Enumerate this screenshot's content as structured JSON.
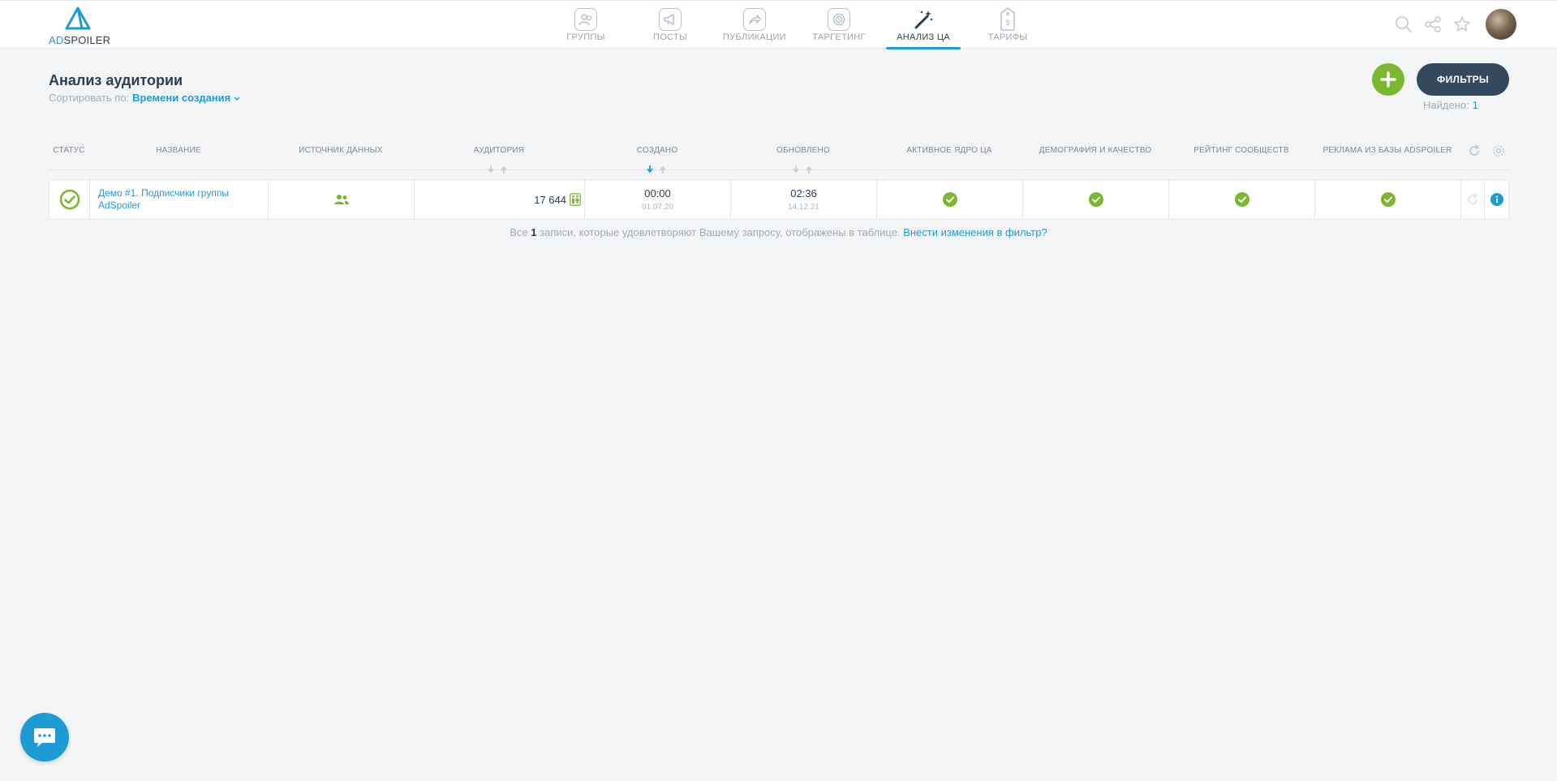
{
  "brand": {
    "logo_ad": "AD",
    "logo_rest": "SPOILER",
    "accent": "#1e9bd7",
    "green": "#7cb82f",
    "dark": "#34495e"
  },
  "nav": [
    {
      "label": "ГРУППЫ",
      "icon": "groups-icon"
    },
    {
      "label": "ПОСТЫ",
      "icon": "megaphone-icon"
    },
    {
      "label": "ПУБЛИКАЦИИ",
      "icon": "share-arrow-icon"
    },
    {
      "label": "ТАРГЕТИНГ",
      "icon": "target-icon"
    },
    {
      "label": "АНАЛИЗ ЦА",
      "icon": "magic-wand-icon",
      "active": true
    },
    {
      "label": "ТАРИФЫ",
      "icon": "price-tag-icon"
    }
  ],
  "page": {
    "title": "Анализ аудитории",
    "sort_label": "Сортировать по:",
    "sort_value": "Времени создания",
    "filters_button": "ФИЛЬТРЫ",
    "found_label": "Найдено:",
    "found_count": "1"
  },
  "table": {
    "headers": {
      "status": "СТАТУС",
      "name": "НАЗВАНИЕ",
      "source": "ИСТОЧНИК ДАННЫХ",
      "audience": "АУДИТОРИЯ",
      "created": "СОЗДАНО",
      "updated": "ОБНОВЛЕНО",
      "core": "АКТИВНОЕ ЯДРО ЦА",
      "demo": "ДЕМОГРАФИЯ И КАЧЕСТВО",
      "rating": "РЕЙТИНГ СООБЩЕСТВ",
      "ads": "РЕКЛАМА ИЗ БАЗЫ ADSPOILER"
    },
    "rows": [
      {
        "name": "Демо #1. Подписчики группы AdSpoiler",
        "audience": "17 644",
        "created_time": "00:00",
        "created_date": "01.07.20",
        "updated_time": "02:36",
        "updated_date": "14.12.21"
      }
    ]
  },
  "footer": {
    "prefix": "Все",
    "count": "1",
    "middle": "записи, которые удовлетворяют Вашему запросу, отображены в таблице.",
    "link": "Внести изменения в фильтр?"
  }
}
